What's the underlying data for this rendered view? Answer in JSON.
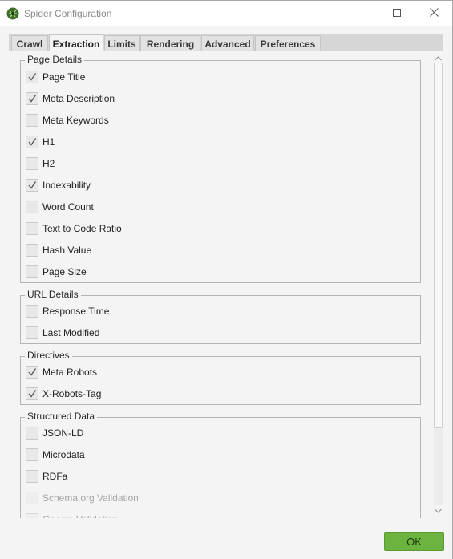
{
  "window": {
    "title": "Spider Configuration",
    "icons": {
      "app": "spider-logo-icon",
      "minimize": "minimize-icon",
      "maximize": "maximize-icon",
      "close": "close-icon"
    }
  },
  "tabs": [
    {
      "label": "Crawl",
      "active": false
    },
    {
      "label": "Extraction",
      "active": true
    },
    {
      "label": "Limits",
      "active": false
    },
    {
      "label": "Rendering",
      "active": false
    },
    {
      "label": "Advanced",
      "active": false
    },
    {
      "label": "Preferences",
      "active": false
    }
  ],
  "groups": {
    "page_details": {
      "title": "Page Details",
      "items": [
        {
          "label": "Page Title",
          "checked": true
        },
        {
          "label": "Meta Description",
          "checked": true
        },
        {
          "label": "Meta Keywords",
          "checked": false
        },
        {
          "label": "H1",
          "checked": true
        },
        {
          "label": "H2",
          "checked": false
        },
        {
          "label": "Indexability",
          "checked": true
        },
        {
          "label": "Word Count",
          "checked": false
        },
        {
          "label": "Text to Code Ratio",
          "checked": false
        },
        {
          "label": "Hash Value",
          "checked": false
        },
        {
          "label": "Page Size",
          "checked": false
        }
      ]
    },
    "url_details": {
      "title": "URL Details",
      "items": [
        {
          "label": "Response Time",
          "checked": false
        },
        {
          "label": "Last Modified",
          "checked": false
        }
      ]
    },
    "directives": {
      "title": "Directives",
      "items": [
        {
          "label": "Meta Robots",
          "checked": true
        },
        {
          "label": "X-Robots-Tag",
          "checked": true
        }
      ]
    },
    "structured_data": {
      "title": "Structured Data",
      "items": [
        {
          "label": "JSON-LD",
          "checked": false,
          "disabled": false
        },
        {
          "label": "Microdata",
          "checked": false,
          "disabled": false
        },
        {
          "label": "RDFa",
          "checked": false,
          "disabled": false
        },
        {
          "label": "Schema.org Validation",
          "checked": false,
          "disabled": true
        },
        {
          "label": "Google Validation",
          "checked": false,
          "disabled": true
        }
      ]
    }
  },
  "scrollbar": {
    "icons": {
      "up": "chevron-up-icon",
      "down": "chevron-down-icon"
    }
  },
  "footer": {
    "ok_label": "OK"
  },
  "colors": {
    "ok_green": "#6db33f",
    "checkmark": "#555555",
    "disabled_text": "#a6a6a6"
  }
}
